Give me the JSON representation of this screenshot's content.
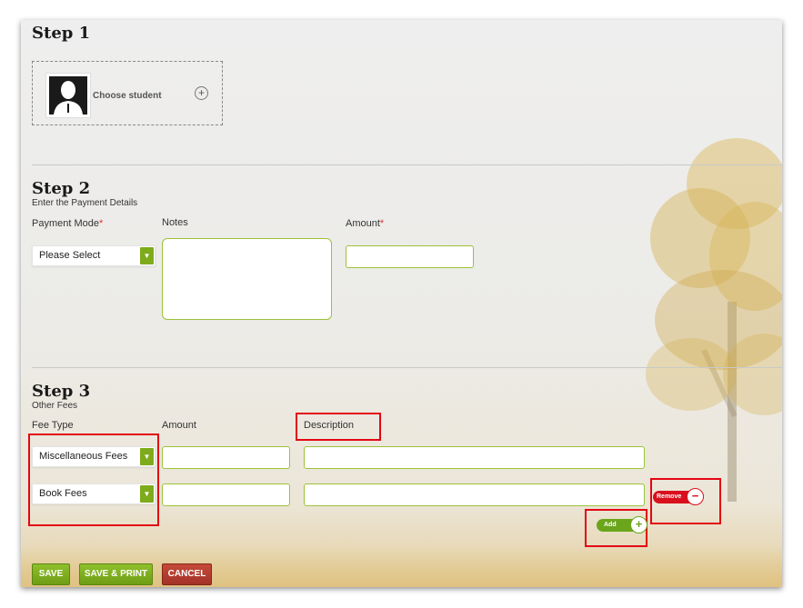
{
  "step1": {
    "title": "Step 1",
    "choose_student": "Choose student",
    "add_icon": "plus-circle-icon"
  },
  "step2": {
    "title": "Step 2",
    "subtitle": "Enter the Payment Details",
    "payment_mode_label": "Payment Mode",
    "notes_label": "Notes",
    "amount_label": "Amount",
    "required_marker": "*",
    "payment_mode_value": "Please Select",
    "notes_value": "",
    "amount_value": ""
  },
  "step3": {
    "title": "Step 3",
    "subtitle": "Other Fees",
    "fee_type_label": "Fee Type",
    "amount_label": "Amount",
    "description_label": "Description",
    "rows": [
      {
        "fee_type": "Miscellaneous Fees",
        "amount": "",
        "description": ""
      },
      {
        "fee_type": "Book Fees",
        "amount": "",
        "description": ""
      }
    ],
    "remove_label": "Remove",
    "add_label": "Add"
  },
  "buttons": {
    "save": "SAVE",
    "save_print": "SAVE & PRINT",
    "cancel": "CANCEL"
  },
  "colors": {
    "accent_green": "#7eab1b",
    "highlight_red": "#e30613",
    "cancel_red": "#b63b2e"
  }
}
